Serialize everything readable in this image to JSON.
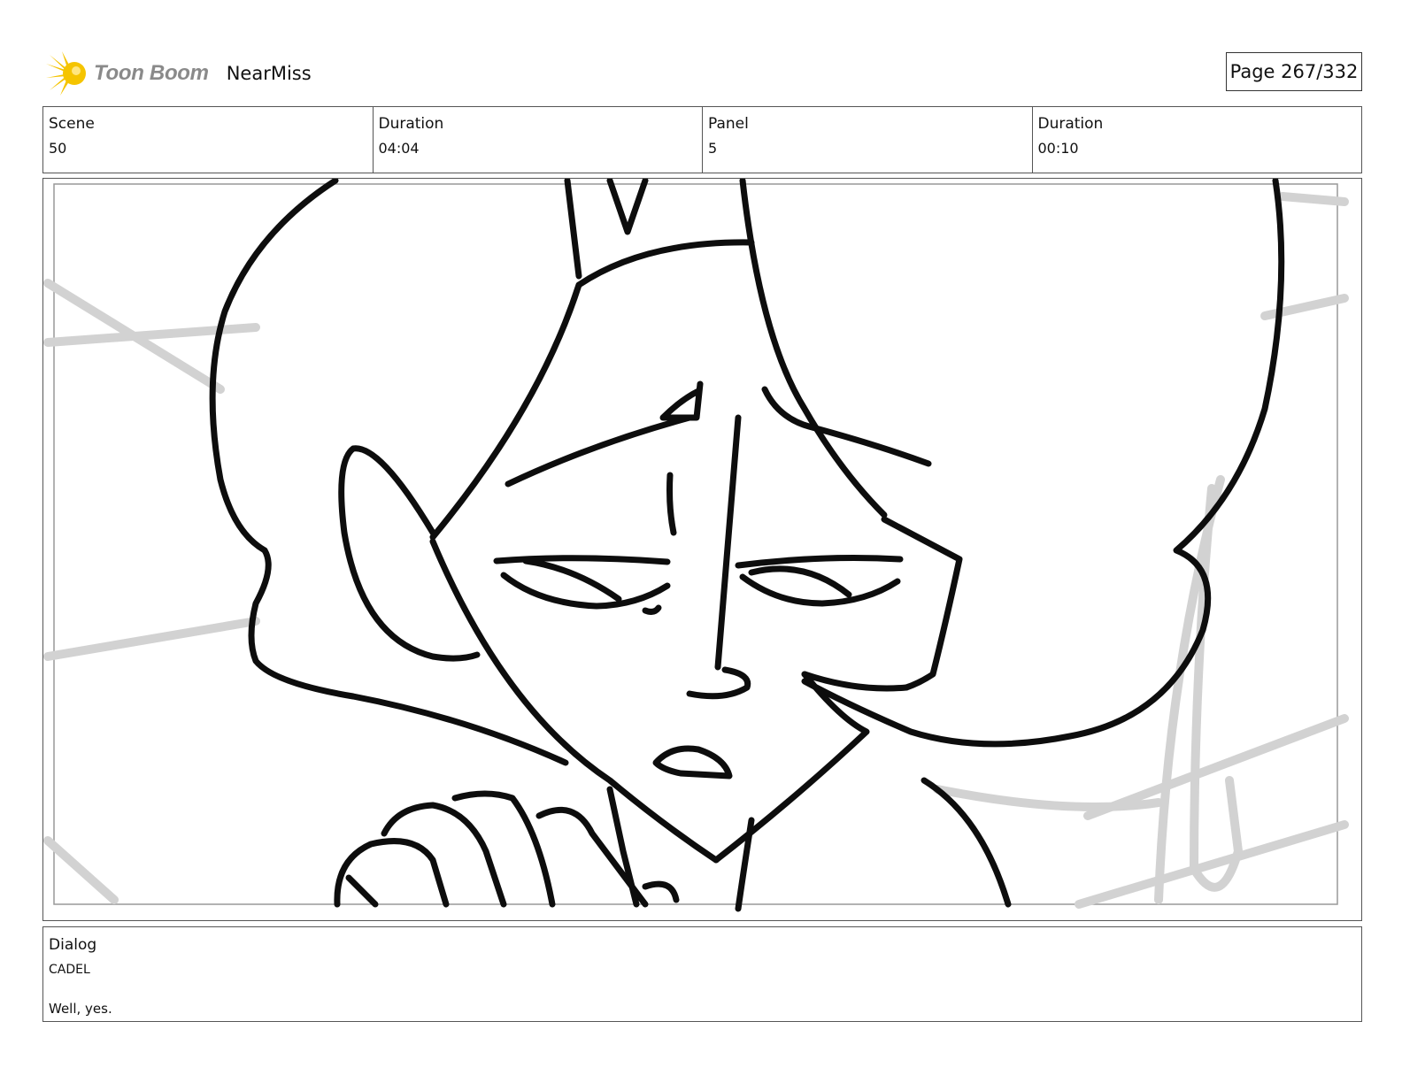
{
  "header": {
    "brand": "Toon Boom",
    "project": "NearMiss",
    "page": "Page 267/332"
  },
  "info": {
    "scene_label": "Scene",
    "scene_value": "50",
    "scene_duration_label": "Duration",
    "scene_duration_value": "04:04",
    "panel_label": "Panel",
    "panel_value": "5",
    "panel_duration_label": "Duration",
    "panel_duration_value": "00:10"
  },
  "dialog": {
    "label": "Dialog",
    "speaker": "CADEL",
    "line": "Well, yes."
  },
  "colors": {
    "logo_yellow": "#f5c400",
    "logo_text": "#8a8a8a",
    "border": "#555555",
    "sketch_line": "#111111",
    "sketch_guide": "#cfcfcf"
  }
}
